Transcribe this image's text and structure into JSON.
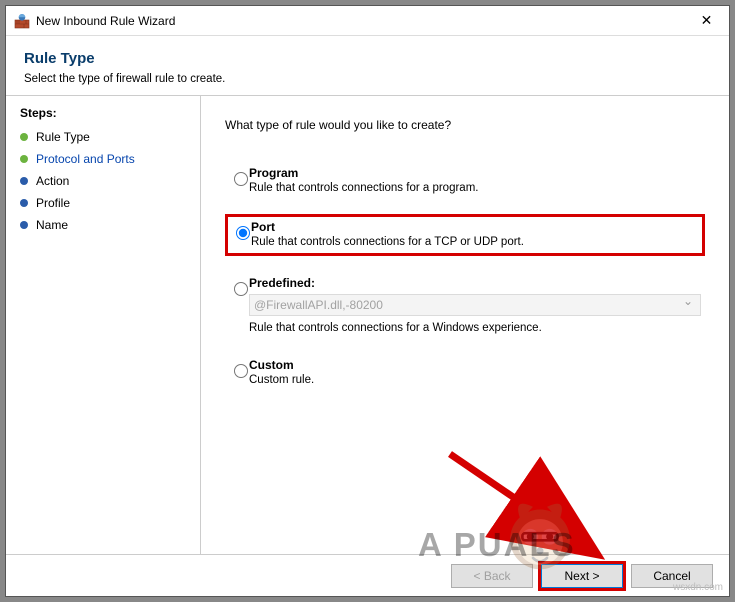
{
  "window": {
    "title": "New Inbound Rule Wizard"
  },
  "header": {
    "heading": "Rule Type",
    "subheading": "Select the type of firewall rule to create."
  },
  "sidebar": {
    "label": "Steps:",
    "items": [
      {
        "label": "Rule Type"
      },
      {
        "label": "Protocol and Ports"
      },
      {
        "label": "Action"
      },
      {
        "label": "Profile"
      },
      {
        "label": "Name"
      }
    ]
  },
  "main": {
    "prompt": "What type of rule would you like to create?",
    "options": {
      "program": {
        "title": "Program",
        "desc": "Rule that controls connections for a program."
      },
      "port": {
        "title": "Port",
        "desc": "Rule that controls connections for a TCP or UDP port."
      },
      "predefined": {
        "title": "Predefined:",
        "select_value": "@FirewallAPI.dll,-80200",
        "desc": "Rule that controls connections for a Windows experience."
      },
      "custom": {
        "title": "Custom",
        "desc": "Custom rule."
      }
    }
  },
  "footer": {
    "back": "< Back",
    "next": "Next >",
    "cancel": "Cancel"
  },
  "watermark": {
    "brand": "A   PUALS",
    "source": "wsxdn.com"
  }
}
